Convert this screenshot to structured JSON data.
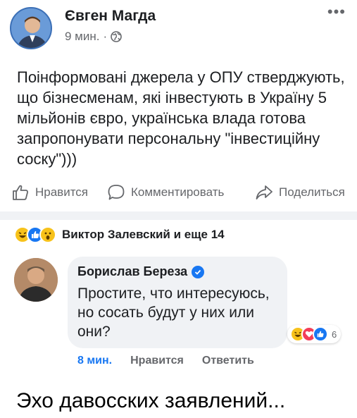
{
  "post": {
    "author": "Євген Магда",
    "time": "9 мин.",
    "separator": "·",
    "more": "•••",
    "text": "Поінформовані джерела у ОПУ стверджують, що бізнесменам, які інвестують в Україну 5 мільйонів євро, українська влада готова запропонувати персональну \"інвестиційну соску\")))"
  },
  "actions": {
    "like": "Нравится",
    "comment": "Комментировать",
    "share": "Поделиться"
  },
  "reactions": {
    "names": "Виктор Залевский и еще 14",
    "icons": [
      "haha-icon",
      "like-icon",
      "wow-icon"
    ]
  },
  "comment": {
    "author": "Борислав Береза",
    "text": "Простите, что интересуюсь, но сосать будут у них или они?",
    "reaction_count": "6",
    "time": "8 мин.",
    "like": "Нравится",
    "reply": "Ответить"
  },
  "caption": "Эхо давосских заявлений..."
}
